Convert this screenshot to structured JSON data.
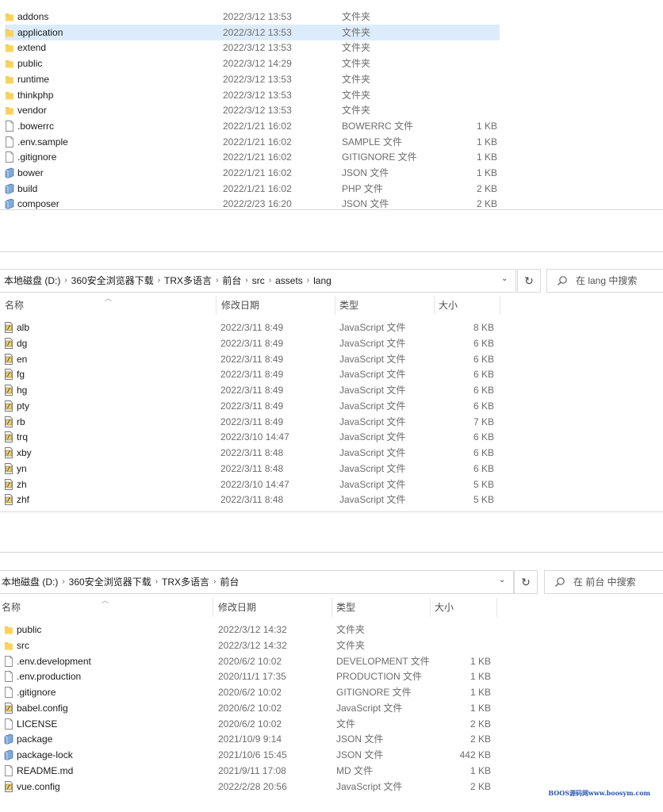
{
  "window1": {
    "files": [
      {
        "name": "addons",
        "date": "2022/3/12 13:53",
        "type": "文件夹",
        "size": "",
        "icon": "folder-icon"
      },
      {
        "name": "application",
        "date": "2022/3/12 13:53",
        "type": "文件夹",
        "size": "",
        "icon": "folder-icon",
        "selected": true
      },
      {
        "name": "extend",
        "date": "2022/3/12 13:53",
        "type": "文件夹",
        "size": "",
        "icon": "folder-icon"
      },
      {
        "name": "public",
        "date": "2022/3/12 14:29",
        "type": "文件夹",
        "size": "",
        "icon": "folder-icon"
      },
      {
        "name": "runtime",
        "date": "2022/3/12 13:53",
        "type": "文件夹",
        "size": "",
        "icon": "folder-icon"
      },
      {
        "name": "thinkphp",
        "date": "2022/3/12 13:53",
        "type": "文件夹",
        "size": "",
        "icon": "folder-icon"
      },
      {
        "name": "vendor",
        "date": "2022/3/12 13:53",
        "type": "文件夹",
        "size": "",
        "icon": "folder-icon"
      },
      {
        "name": ".bowerrc",
        "date": "2022/1/21 16:02",
        "type": "BOWERRC 文件",
        "size": "1 KB",
        "icon": "file-icon"
      },
      {
        "name": ".env.sample",
        "date": "2022/1/21 16:02",
        "type": "SAMPLE 文件",
        "size": "1 KB",
        "icon": "file-icon"
      },
      {
        "name": ".gitignore",
        "date": "2022/1/21 16:02",
        "type": "GITIGNORE 文件",
        "size": "1 KB",
        "icon": "file-icon"
      },
      {
        "name": "bower",
        "date": "2022/1/21 16:02",
        "type": "JSON 文件",
        "size": "1 KB",
        "icon": "json-file-icon"
      },
      {
        "name": "build",
        "date": "2022/1/21 16:02",
        "type": "PHP 文件",
        "size": "2 KB",
        "icon": "json-file-icon"
      },
      {
        "name": "composer",
        "date": "2022/2/23 16:20",
        "type": "JSON 文件",
        "size": "2 KB",
        "icon": "json-file-icon"
      }
    ]
  },
  "window2": {
    "breadcrumb": [
      "本地磁盘 (D:)",
      "360安全浏览器下载",
      "TRX多语言",
      "前台",
      "src",
      "assets",
      "lang"
    ],
    "search_placeholder": "在 lang 中搜索",
    "refresh_glyph": "↻",
    "dropdown_glyph": "⌄",
    "columns": {
      "name": "名称",
      "date": "修改日期",
      "type": "类型",
      "size": "大小"
    },
    "files": [
      {
        "name": "alb",
        "date": "2022/3/11 8:49",
        "type": "JavaScript 文件",
        "size": "8 KB",
        "icon": "js-file-icon"
      },
      {
        "name": "dg",
        "date": "2022/3/11 8:49",
        "type": "JavaScript 文件",
        "size": "6 KB",
        "icon": "js-file-icon"
      },
      {
        "name": "en",
        "date": "2022/3/11 8:49",
        "type": "JavaScript 文件",
        "size": "6 KB",
        "icon": "js-file-icon"
      },
      {
        "name": "fg",
        "date": "2022/3/11 8:49",
        "type": "JavaScript 文件",
        "size": "6 KB",
        "icon": "js-file-icon"
      },
      {
        "name": "hg",
        "date": "2022/3/11 8:49",
        "type": "JavaScript 文件",
        "size": "6 KB",
        "icon": "js-file-icon"
      },
      {
        "name": "pty",
        "date": "2022/3/11 8:49",
        "type": "JavaScript 文件",
        "size": "6 KB",
        "icon": "js-file-icon"
      },
      {
        "name": "rb",
        "date": "2022/3/11 8:49",
        "type": "JavaScript 文件",
        "size": "7 KB",
        "icon": "js-file-icon"
      },
      {
        "name": "trq",
        "date": "2022/3/10 14:47",
        "type": "JavaScript 文件",
        "size": "6 KB",
        "icon": "js-file-icon"
      },
      {
        "name": "xby",
        "date": "2022/3/11 8:48",
        "type": "JavaScript 文件",
        "size": "6 KB",
        "icon": "js-file-icon"
      },
      {
        "name": "yn",
        "date": "2022/3/11 8:48",
        "type": "JavaScript 文件",
        "size": "6 KB",
        "icon": "js-file-icon"
      },
      {
        "name": "zh",
        "date": "2022/3/10 14:47",
        "type": "JavaScript 文件",
        "size": "5 KB",
        "icon": "js-file-icon"
      },
      {
        "name": "zhf",
        "date": "2022/3/11 8:48",
        "type": "JavaScript 文件",
        "size": "5 KB",
        "icon": "js-file-icon"
      }
    ]
  },
  "window3": {
    "breadcrumb": [
      "本地磁盘 (D:)",
      "360安全浏览器下载",
      "TRX多语言",
      "前台"
    ],
    "search_placeholder": "在 前台 中搜索",
    "refresh_glyph": "↻",
    "dropdown_glyph": "⌄",
    "columns": {
      "name": "名称",
      "date": "修改日期",
      "type": "类型",
      "size": "大小"
    },
    "files": [
      {
        "name": "public",
        "date": "2022/3/12 14:32",
        "type": "文件夹",
        "size": "",
        "icon": "folder-icon"
      },
      {
        "name": "src",
        "date": "2022/3/12 14:32",
        "type": "文件夹",
        "size": "",
        "icon": "folder-icon"
      },
      {
        "name": ".env.development",
        "date": "2020/6/2 10:02",
        "type": "DEVELOPMENT 文件",
        "size": "1 KB",
        "icon": "file-icon"
      },
      {
        "name": ".env.production",
        "date": "2020/11/1 17:35",
        "type": "PRODUCTION 文件",
        "size": "1 KB",
        "icon": "file-icon"
      },
      {
        "name": ".gitignore",
        "date": "2020/6/2 10:02",
        "type": "GITIGNORE 文件",
        "size": "1 KB",
        "icon": "file-icon"
      },
      {
        "name": "babel.config",
        "date": "2020/6/2 10:02",
        "type": "JavaScript 文件",
        "size": "1 KB",
        "icon": "js-file-icon"
      },
      {
        "name": "LICENSE",
        "date": "2020/6/2 10:02",
        "type": "文件",
        "size": "2 KB",
        "icon": "file-icon"
      },
      {
        "name": "package",
        "date": "2021/10/9 9:14",
        "type": "JSON 文件",
        "size": "2 KB",
        "icon": "json-file-icon"
      },
      {
        "name": "package-lock",
        "date": "2021/10/6 15:45",
        "type": "JSON 文件",
        "size": "442 KB",
        "icon": "json-file-icon"
      },
      {
        "name": "README.md",
        "date": "2021/9/11 17:08",
        "type": "MD 文件",
        "size": "1 KB",
        "icon": "file-icon"
      },
      {
        "name": "vue.config",
        "date": "2022/2/28 20:56",
        "type": "JavaScript 文件",
        "size": "2 KB",
        "icon": "js-file-icon"
      }
    ]
  },
  "watermark": "BOOS源码网www.boosym.com",
  "colors": {
    "selection": "#dcecfc",
    "folder": "#f8c848",
    "text_secondary": "#6d6d6d",
    "watermark": "#2b56b2"
  }
}
